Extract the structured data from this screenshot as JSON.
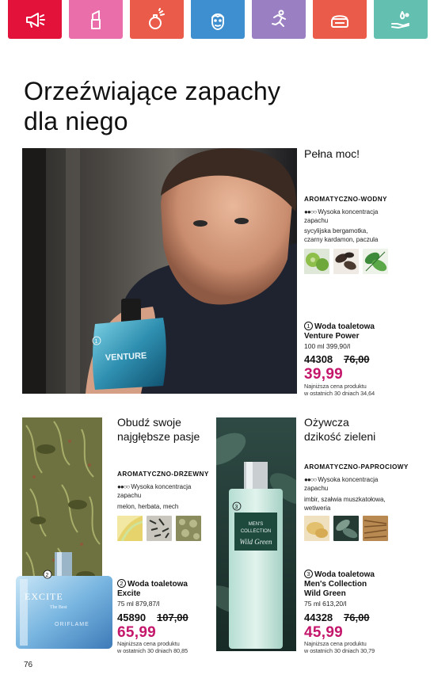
{
  "nav": {
    "categories": [
      {
        "name": "promotions",
        "color": "#e2123a"
      },
      {
        "name": "makeup",
        "color": "#e96ea9"
      },
      {
        "name": "fragrance",
        "color": "#ea5b4a"
      },
      {
        "name": "men",
        "color": "#3e8fcf"
      },
      {
        "name": "wellness",
        "color": "#9a7fc3"
      },
      {
        "name": "skincare",
        "color": "#ea5b4a"
      },
      {
        "name": "personal-care",
        "color": "#63c0b0"
      }
    ]
  },
  "heading": {
    "line1": "Orzeźwiające zapachy",
    "line2": "dla niego"
  },
  "products": [
    {
      "tagline": "Pełna moc!",
      "family": "AROMATYCZNO-WODNY",
      "concentration": "Wysoka koncentracja zapachu",
      "notes": "sycylijska bergamotka, czarny kardamon, paczula",
      "number": "1",
      "name_line1": "Woda toaletowa",
      "name_line2": "Venture Power",
      "detail": "100 ml 399,90/l",
      "code": "44308",
      "old_price": "76,00",
      "price": "39,99",
      "lowest_line1": "Najniższa cena produktu",
      "lowest_line2": "w ostatnich 30 dniach 34,64"
    },
    {
      "tagline_line1": "Obudź swoje",
      "tagline_line2": "najgłębsze pasje",
      "family": "AROMATYCZNO-DRZEWNY",
      "concentration": "Wysoka koncentracja zapachu",
      "notes": "melon, herbata, mech",
      "number": "2",
      "name_line1": "Woda toaletowa",
      "name_line2": "Excite",
      "detail": "75 ml 879,87/l",
      "code": "45890",
      "old_price": "107,00",
      "price": "65,99",
      "lowest_line1": "Najniższa cena produktu",
      "lowest_line2": "w ostatnich 30 dniach 80,85",
      "bottle_brand": "EXCITE",
      "bottle_sub": "The Best",
      "bottle_maker": "ORIFLAME"
    },
    {
      "tagline_line1": "Ożywcza",
      "tagline_line2": "dzikość zieleni",
      "family": "AROMATYCZNO-PAPROCIOWY",
      "concentration": "Wysoka koncentracja zapachu",
      "notes": "imbir, szałwia muszkatołowa, wetiweria",
      "number": "3",
      "name_line1": "Woda toaletowa",
      "name_line2": "Men's Collection",
      "name_line3": "Wild Green",
      "detail": "75 ml 613,20/l",
      "code": "44328",
      "old_price": "76,00",
      "price": "45,99",
      "lowest_line1": "Najniższa cena produktu",
      "lowest_line2": "w ostatnich 30 dniach 30,79",
      "bottle_line1": "MEN'S",
      "bottle_line2": "COLLECTION",
      "bottle_line3": "Wild Green"
    }
  ],
  "page_number": "76"
}
